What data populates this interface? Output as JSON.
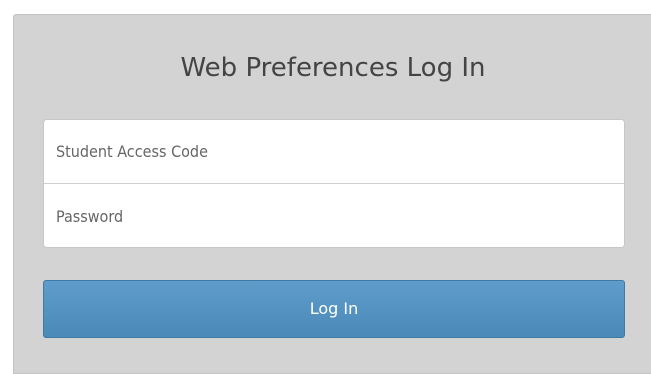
{
  "login": {
    "title": "Web Preferences Log In",
    "access_code_placeholder": "Student Access Code",
    "access_code_value": "",
    "password_placeholder": "Password",
    "password_value": "",
    "submit_label": "Log In"
  },
  "colors": {
    "panel_background": "#d3d3d3",
    "button_background": "#4a89b8",
    "button_text": "#ffffff",
    "title_text": "#444444"
  }
}
